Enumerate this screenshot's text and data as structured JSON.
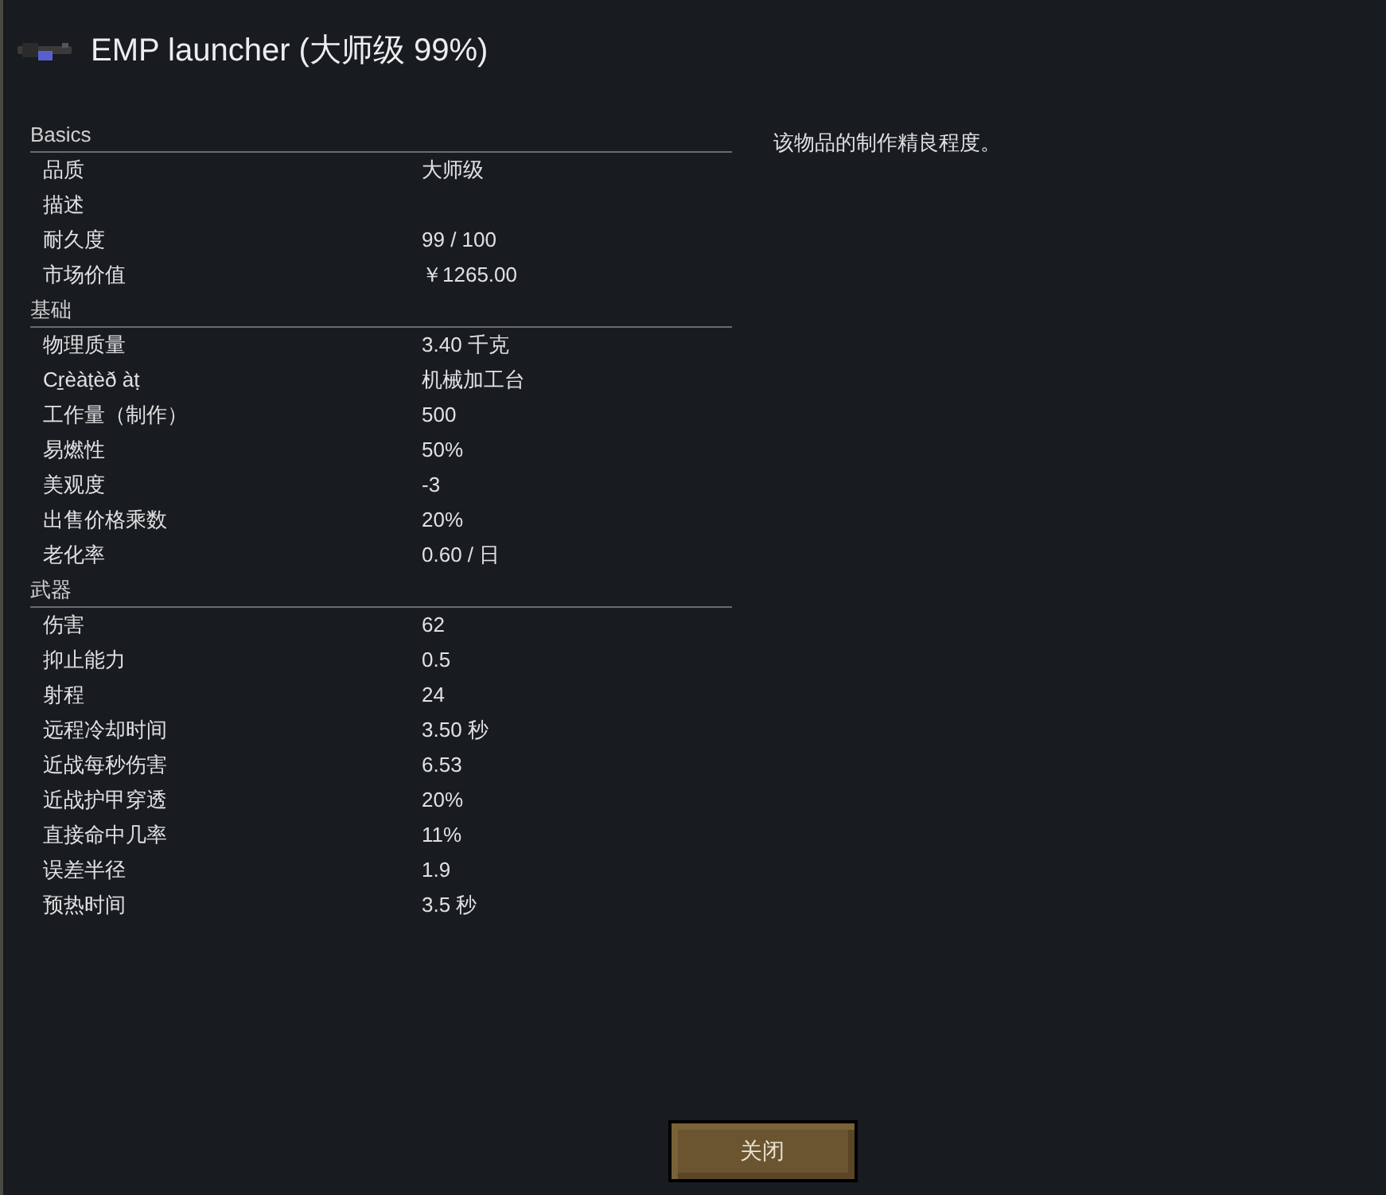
{
  "window": {
    "title": "EMP launcher (大师级 99%)"
  },
  "sections": [
    {
      "title": "Basics",
      "rows": [
        {
          "label": "品质",
          "value": "大师级"
        },
        {
          "label": "描述"
        },
        {
          "label": "耐久度",
          "value": "99 / 100"
        },
        {
          "label": "市场价值",
          "value": "￥1265.00"
        }
      ]
    },
    {
      "title": "基础",
      "rows": [
        {
          "label": "物理质量",
          "value": "3.40 千克"
        },
        {
          "label": "Cr̠èàṭèð àṭ",
          "value": "机械加工台"
        },
        {
          "label": "工作量（制作）",
          "value": "500"
        },
        {
          "label": "易燃性",
          "value": "50%"
        },
        {
          "label": "美观度",
          "value": "-3"
        },
        {
          "label": "出售价格乘数",
          "value": "20%"
        },
        {
          "label": "老化率",
          "value": "0.60 / 日"
        }
      ]
    },
    {
      "title": "武器",
      "rows": [
        {
          "label": "伤害",
          "value": "62"
        },
        {
          "label": "抑止能力",
          "value": "0.5"
        },
        {
          "label": "射程",
          "value": "24"
        },
        {
          "label": "远程冷却时间",
          "value": "3.50 秒"
        },
        {
          "label": "近战每秒伤害",
          "value": "6.53"
        },
        {
          "label": "近战护甲穿透",
          "value": "20%"
        },
        {
          "label": "直接命中几率",
          "value": "11%"
        },
        {
          "label": "误差半径",
          "value": "1.9"
        },
        {
          "label": "预热时间",
          "value": "3.5 秒"
        }
      ]
    }
  ],
  "description": "该物品的制作精良程度。",
  "close_button": "关闭"
}
